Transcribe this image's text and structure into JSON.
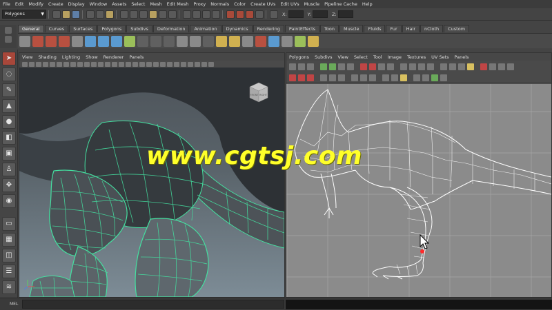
{
  "menubar": {
    "items": [
      "File",
      "Edit",
      "Modify",
      "Create",
      "Display",
      "Window",
      "Assets",
      "Select",
      "Mesh",
      "Edit Mesh",
      "Proxy",
      "Normals",
      "Color",
      "Create UVs",
      "Edit UVs",
      "Muscle",
      "Pipeline Cache",
      "Help"
    ]
  },
  "statusline": {
    "mode": "Polygons",
    "x_label": "X:",
    "y_label": "Y:",
    "z_label": "Z:"
  },
  "shelf": {
    "tabs": [
      "General",
      "Curves",
      "Surfaces",
      "Polygons",
      "Subdivs",
      "Deformation",
      "Animation",
      "Dynamics",
      "Rendering",
      "PaintEffects",
      "Toon",
      "Muscle",
      "Fluids",
      "Fur",
      "Hair",
      "nCloth",
      "Custom"
    ],
    "active_tab": "General"
  },
  "perspective_panel": {
    "menu": [
      "View",
      "Shading",
      "Lighting",
      "Show",
      "Renderer",
      "Panels"
    ],
    "viewcube_faces": [
      "FRONT",
      "RIGHT"
    ]
  },
  "uv_panel": {
    "menu": [
      "Polygons",
      "Subdivs",
      "View",
      "Select",
      "Tool",
      "Image",
      "Textures",
      "UV Sets",
      "Panels"
    ]
  },
  "watermark": "www.cgtsj.com",
  "command_line": {
    "label": "MEL"
  },
  "colors": {
    "wire_green": "#44e0a0",
    "uv_background": "#8b8b8b",
    "watermark": "#ffff2a",
    "selected_tool": "#a8473a"
  }
}
